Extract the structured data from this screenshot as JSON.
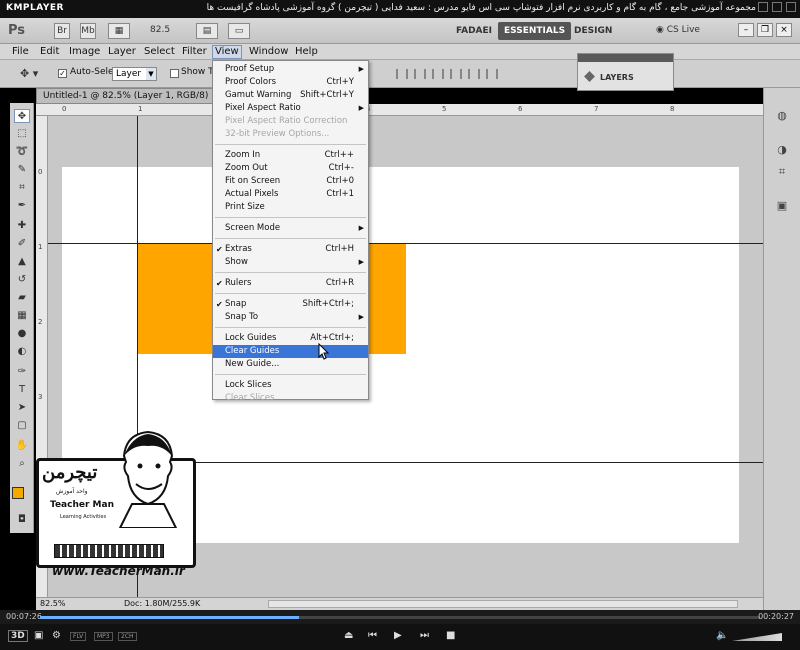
{
  "player": {
    "logo": "KMPLAYER",
    "caption": "مجموعه آموزشی جامع ، گام به گام و کاربردی نرم افزار فتوشاپ سی اس فایو  مدرس : سعید فدایی ( تیچرمن ) گروه آموزشی پادشاه گرافیست ها",
    "time_elapsed": "00:07:26",
    "time_total": "00:20:27",
    "progress": 0.36,
    "tags": [
      "FLV",
      "MP3",
      "2CH"
    ]
  },
  "ps": {
    "logo": "Ps",
    "chips": [
      "Br",
      "Mb"
    ],
    "zoom": "82.5",
    "workspaces": [
      "FADAEI",
      "ESSENTIALS",
      "DESIGN"
    ],
    "active_workspace": "ESSENTIALS",
    "cs_live": "CS Live",
    "menus": [
      "File",
      "Edit",
      "Image",
      "Layer",
      "Select",
      "Filter",
      "View",
      "Window",
      "Help"
    ],
    "open_menu": "View"
  },
  "options": {
    "auto_select_label": "Auto-Select:",
    "auto_select_value": "Layer",
    "show_transform_label": "Show Tr"
  },
  "layers_panel": {
    "label": "LAYERS"
  },
  "document": {
    "tab": "Untitled-1 @ 82.5% (Layer 1, RGB/8) *",
    "zoom_status": "82.5%",
    "doc_status": "Doc: 1.80M/255.9K",
    "fill_color": "#ffa500"
  },
  "rulers": {
    "top": [
      "0",
      "1",
      "2",
      "3",
      "4",
      "5",
      "6",
      "7",
      "8"
    ],
    "left": [
      "0",
      "1",
      "2",
      "3",
      "4",
      "5"
    ]
  },
  "view_menu": {
    "items": [
      {
        "label": "Proof Setup",
        "shortcut": "",
        "submenu": true,
        "disabled": false,
        "checked": false
      },
      {
        "label": "Proof Colors",
        "shortcut": "Ctrl+Y",
        "submenu": false,
        "disabled": false,
        "checked": false
      },
      {
        "label": "Gamut Warning",
        "shortcut": "Shift+Ctrl+Y",
        "submenu": false,
        "disabled": false,
        "checked": false
      },
      {
        "label": "Pixel Aspect Ratio",
        "shortcut": "",
        "submenu": true,
        "disabled": false,
        "checked": false
      },
      {
        "label": "Pixel Aspect Ratio Correction",
        "shortcut": "",
        "submenu": false,
        "disabled": true,
        "checked": false
      },
      {
        "label": "32-bit Preview Options...",
        "shortcut": "",
        "submenu": false,
        "disabled": true,
        "checked": false
      },
      {
        "label": "Zoom In",
        "shortcut": "Ctrl++",
        "submenu": false,
        "disabled": false,
        "checked": false
      },
      {
        "label": "Zoom Out",
        "shortcut": "Ctrl+-",
        "submenu": false,
        "disabled": false,
        "checked": false
      },
      {
        "label": "Fit on Screen",
        "shortcut": "Ctrl+0",
        "submenu": false,
        "disabled": false,
        "checked": false
      },
      {
        "label": "Actual Pixels",
        "shortcut": "Ctrl+1",
        "submenu": false,
        "disabled": false,
        "checked": false
      },
      {
        "label": "Print Size",
        "shortcut": "",
        "submenu": false,
        "disabled": false,
        "checked": false
      },
      {
        "label": "Screen Mode",
        "shortcut": "",
        "submenu": true,
        "disabled": false,
        "checked": false
      },
      {
        "label": "Extras",
        "shortcut": "Ctrl+H",
        "submenu": false,
        "disabled": false,
        "checked": true
      },
      {
        "label": "Show",
        "shortcut": "",
        "submenu": true,
        "disabled": false,
        "checked": false
      },
      {
        "label": "Rulers",
        "shortcut": "Ctrl+R",
        "submenu": false,
        "disabled": false,
        "checked": true
      },
      {
        "label": "Snap",
        "shortcut": "Shift+Ctrl+;",
        "submenu": false,
        "disabled": false,
        "checked": true
      },
      {
        "label": "Snap To",
        "shortcut": "",
        "submenu": true,
        "disabled": false,
        "checked": false
      },
      {
        "label": "Lock Guides",
        "shortcut": "Alt+Ctrl+;",
        "submenu": false,
        "disabled": false,
        "checked": false
      },
      {
        "label": "Clear Guides",
        "shortcut": "",
        "submenu": false,
        "disabled": false,
        "checked": false,
        "highlighted": true
      },
      {
        "label": "New Guide...",
        "shortcut": "",
        "submenu": false,
        "disabled": false,
        "checked": false
      },
      {
        "label": "Lock Slices",
        "shortcut": "",
        "submenu": false,
        "disabled": false,
        "checked": false
      },
      {
        "label": "Clear Slices",
        "shortcut": "",
        "submenu": false,
        "disabled": true,
        "checked": false
      }
    ]
  },
  "watermark": {
    "fa_title": "تیچرمن",
    "fa_sub": "واحد آموزش",
    "en_title": "Teacher Man",
    "en_sub": "Learning Activities",
    "url": "www.TeacherMan.ir"
  }
}
